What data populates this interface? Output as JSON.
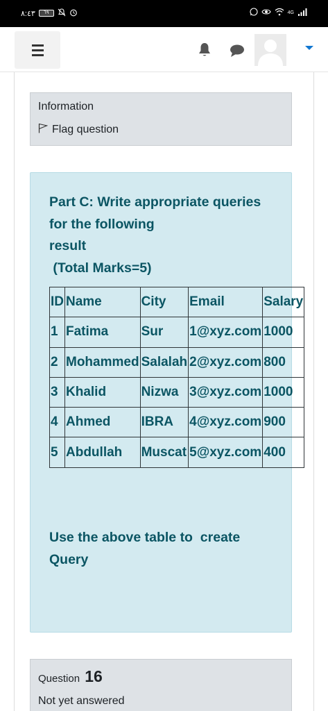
{
  "status_bar": {
    "time": "٨:٤٣",
    "battery": "٦٩",
    "network": "4G"
  },
  "navbar": {
    "menu_icon": "hamburger-icon",
    "bell_icon": "bell-icon",
    "chat_icon": "chat-icon"
  },
  "info": {
    "title": "Information",
    "flag_label": "Flag question"
  },
  "question": {
    "lines": [
      "Part C: Write appropriate queries",
      "for the following",
      "result",
      " (Total Marks=5)"
    ],
    "table": {
      "headers": [
        "ID",
        "Name",
        "City",
        "Email",
        "Salary"
      ],
      "rows": [
        [
          "1",
          "Fatima",
          "Sur",
          "1@xyz.com",
          "1000"
        ],
        [
          "2",
          "Mohammed",
          "Salalah",
          "2@xyz.com",
          "800"
        ],
        [
          "3",
          "Khalid",
          "Nizwa",
          "3@xyz.com",
          "1000"
        ],
        [
          "4",
          "Ahmed",
          "IBRA",
          "4@xyz.com",
          "900"
        ],
        [
          "5",
          "Abdullah",
          "Muscat",
          "5@xyz.com",
          "400"
        ]
      ]
    },
    "footnote_lines": [
      "Use the above table to  create",
      "Query"
    ]
  },
  "next_question": {
    "label": "Question",
    "number": "16",
    "status": "Not yet answered"
  },
  "colors": {
    "question_bg": "#d3eaf0",
    "question_text": "#0b5563",
    "info_bg": "#dee2e6",
    "accent": "#1177d1"
  }
}
